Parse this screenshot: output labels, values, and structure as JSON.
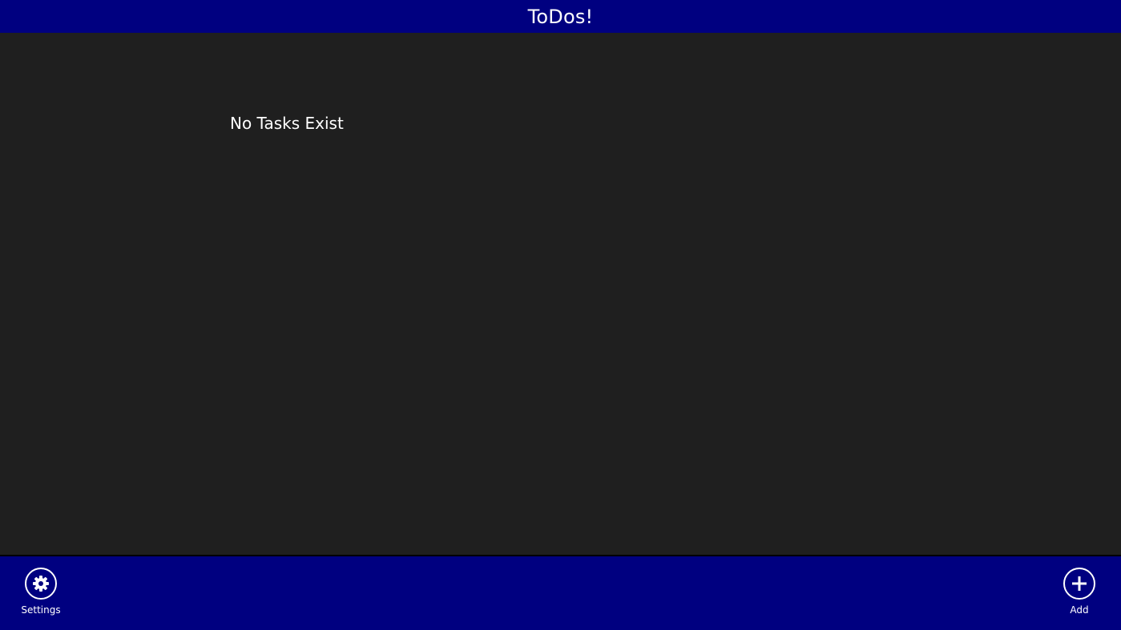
{
  "header": {
    "title": "ToDos!"
  },
  "main": {
    "empty_message": "No Tasks Exist"
  },
  "app_bar": {
    "settings": {
      "label": "Settings",
      "icon": "gear-icon"
    },
    "add": {
      "label": "Add",
      "icon": "plus-icon"
    }
  },
  "colors": {
    "accent": "#000080",
    "background": "#1f1f1f",
    "text": "#ffffff"
  }
}
